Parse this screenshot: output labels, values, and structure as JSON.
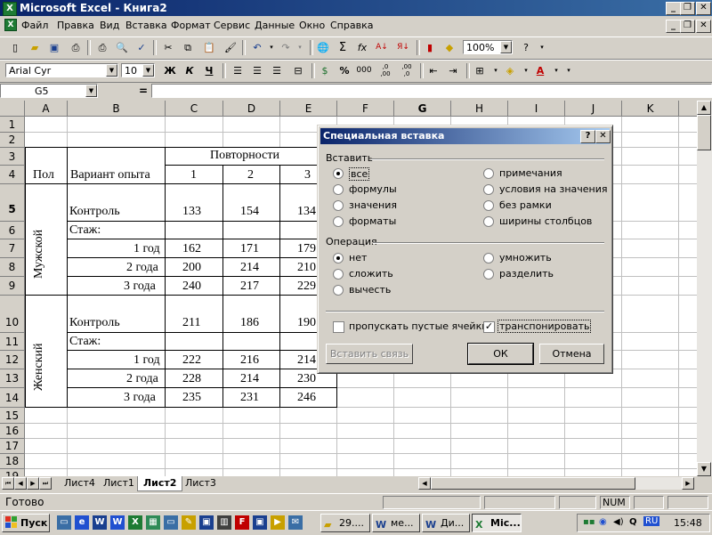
{
  "window": {
    "title": "Microsoft Excel - Книга2",
    "app_icon": "excel-icon"
  },
  "menu": [
    "Файл",
    "Правка",
    "Вид",
    "Вставка",
    "Формат",
    "Сервис",
    "Данные",
    "Окно",
    "Справка"
  ],
  "toolbar": {
    "zoom": "100%",
    "font_name": "Arial Cyr",
    "font_size": "10",
    "bold": "Ж",
    "italic": "К",
    "underline": "Ч",
    "percent": "%",
    "thousands": "000",
    "inc_decimal": ",0 ,00",
    "dec_decimal": ",00 ,0",
    "sigma": "Σ",
    "fx": "fx"
  },
  "formula_bar": {
    "name_box": "G5",
    "equals": "=",
    "content": ""
  },
  "grid": {
    "columns": [
      "A",
      "B",
      "C",
      "D",
      "E",
      "F",
      "G",
      "H",
      "I",
      "J",
      "K"
    ],
    "rows": [
      "1",
      "2",
      "3",
      "4",
      "5",
      "6",
      "7",
      "8",
      "9",
      "10",
      "11",
      "12",
      "13",
      "14",
      "15",
      "16",
      "17",
      "18",
      "19"
    ],
    "table": {
      "povtornosti": "Повторности",
      "pol": "Пол",
      "variant": "Вариант опыта",
      "rep1": "1",
      "rep2": "2",
      "rep3": "3",
      "male": "Мужской",
      "female": "Женский",
      "kontrol": "Контроль",
      "stazh": "Стаж:",
      "y1": "1 год",
      "y2": "2 года",
      "y3": "3  года",
      "male_control": [
        "133",
        "154",
        "134"
      ],
      "male_y1": [
        "162",
        "171",
        "179"
      ],
      "male_y2": [
        "200",
        "214",
        "210"
      ],
      "male_y3": [
        "240",
        "217",
        "229"
      ],
      "female_control": [
        "211",
        "186",
        "190"
      ],
      "female_y1": [
        "222",
        "216",
        "214"
      ],
      "female_y2": [
        "228",
        "214",
        "230"
      ],
      "female_y3": [
        "235",
        "231",
        "246"
      ]
    }
  },
  "sheets": [
    "Лист4",
    "Лист1",
    "Лист2",
    "Лист3"
  ],
  "active_sheet": "Лист2",
  "status": {
    "text": "Готово",
    "num": "NUM"
  },
  "taskbar": {
    "start": "Пуск",
    "tasks": [
      "29....",
      "ме...",
      "Ди...",
      "Mic..."
    ],
    "lang": "RU",
    "clock": "15:48"
  },
  "dialog": {
    "title": "Специальная вставка",
    "help": "?",
    "close": "✕",
    "paste_group": "Вставить",
    "paste_options": [
      "все",
      "формулы",
      "значения",
      "форматы",
      "примечания",
      "условия на значения",
      "без рамки",
      "ширины столбцов"
    ],
    "paste_selected": "все",
    "operation_group": "Операция",
    "operation_options": [
      "нет",
      "сложить",
      "вычесть",
      "умножить",
      "разделить"
    ],
    "operation_selected": "нет",
    "skip_blanks": {
      "label": "пропускать пустые ячейки",
      "checked": false
    },
    "transpose": {
      "label": "транспонировать",
      "checked": true
    },
    "paste_link": "Вставить связь",
    "ok": "ОК",
    "cancel": "Отмена"
  }
}
